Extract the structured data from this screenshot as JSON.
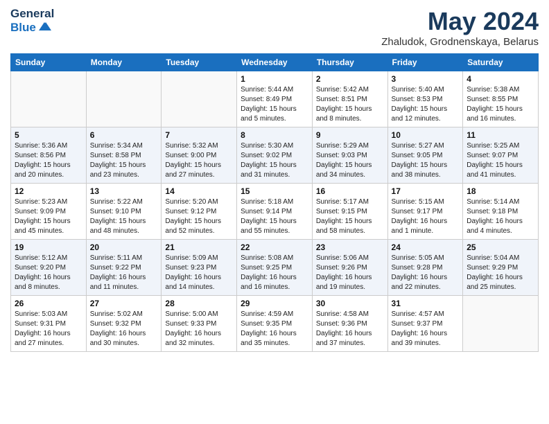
{
  "header": {
    "logo_line1": "General",
    "logo_line2": "Blue",
    "month_year": "May 2024",
    "location": "Zhaludok, Grodnenskaya, Belarus"
  },
  "days_of_week": [
    "Sunday",
    "Monday",
    "Tuesday",
    "Wednesday",
    "Thursday",
    "Friday",
    "Saturday"
  ],
  "weeks": [
    [
      {
        "day": "",
        "info": ""
      },
      {
        "day": "",
        "info": ""
      },
      {
        "day": "",
        "info": ""
      },
      {
        "day": "1",
        "info": "Sunrise: 5:44 AM\nSunset: 8:49 PM\nDaylight: 15 hours\nand 5 minutes."
      },
      {
        "day": "2",
        "info": "Sunrise: 5:42 AM\nSunset: 8:51 PM\nDaylight: 15 hours\nand 8 minutes."
      },
      {
        "day": "3",
        "info": "Sunrise: 5:40 AM\nSunset: 8:53 PM\nDaylight: 15 hours\nand 12 minutes."
      },
      {
        "day": "4",
        "info": "Sunrise: 5:38 AM\nSunset: 8:55 PM\nDaylight: 15 hours\nand 16 minutes."
      }
    ],
    [
      {
        "day": "5",
        "info": "Sunrise: 5:36 AM\nSunset: 8:56 PM\nDaylight: 15 hours\nand 20 minutes."
      },
      {
        "day": "6",
        "info": "Sunrise: 5:34 AM\nSunset: 8:58 PM\nDaylight: 15 hours\nand 23 minutes."
      },
      {
        "day": "7",
        "info": "Sunrise: 5:32 AM\nSunset: 9:00 PM\nDaylight: 15 hours\nand 27 minutes."
      },
      {
        "day": "8",
        "info": "Sunrise: 5:30 AM\nSunset: 9:02 PM\nDaylight: 15 hours\nand 31 minutes."
      },
      {
        "day": "9",
        "info": "Sunrise: 5:29 AM\nSunset: 9:03 PM\nDaylight: 15 hours\nand 34 minutes."
      },
      {
        "day": "10",
        "info": "Sunrise: 5:27 AM\nSunset: 9:05 PM\nDaylight: 15 hours\nand 38 minutes."
      },
      {
        "day": "11",
        "info": "Sunrise: 5:25 AM\nSunset: 9:07 PM\nDaylight: 15 hours\nand 41 minutes."
      }
    ],
    [
      {
        "day": "12",
        "info": "Sunrise: 5:23 AM\nSunset: 9:09 PM\nDaylight: 15 hours\nand 45 minutes."
      },
      {
        "day": "13",
        "info": "Sunrise: 5:22 AM\nSunset: 9:10 PM\nDaylight: 15 hours\nand 48 minutes."
      },
      {
        "day": "14",
        "info": "Sunrise: 5:20 AM\nSunset: 9:12 PM\nDaylight: 15 hours\nand 52 minutes."
      },
      {
        "day": "15",
        "info": "Sunrise: 5:18 AM\nSunset: 9:14 PM\nDaylight: 15 hours\nand 55 minutes."
      },
      {
        "day": "16",
        "info": "Sunrise: 5:17 AM\nSunset: 9:15 PM\nDaylight: 15 hours\nand 58 minutes."
      },
      {
        "day": "17",
        "info": "Sunrise: 5:15 AM\nSunset: 9:17 PM\nDaylight: 16 hours\nand 1 minute."
      },
      {
        "day": "18",
        "info": "Sunrise: 5:14 AM\nSunset: 9:18 PM\nDaylight: 16 hours\nand 4 minutes."
      }
    ],
    [
      {
        "day": "19",
        "info": "Sunrise: 5:12 AM\nSunset: 9:20 PM\nDaylight: 16 hours\nand 8 minutes."
      },
      {
        "day": "20",
        "info": "Sunrise: 5:11 AM\nSunset: 9:22 PM\nDaylight: 16 hours\nand 11 minutes."
      },
      {
        "day": "21",
        "info": "Sunrise: 5:09 AM\nSunset: 9:23 PM\nDaylight: 16 hours\nand 14 minutes."
      },
      {
        "day": "22",
        "info": "Sunrise: 5:08 AM\nSunset: 9:25 PM\nDaylight: 16 hours\nand 16 minutes."
      },
      {
        "day": "23",
        "info": "Sunrise: 5:06 AM\nSunset: 9:26 PM\nDaylight: 16 hours\nand 19 minutes."
      },
      {
        "day": "24",
        "info": "Sunrise: 5:05 AM\nSunset: 9:28 PM\nDaylight: 16 hours\nand 22 minutes."
      },
      {
        "day": "25",
        "info": "Sunrise: 5:04 AM\nSunset: 9:29 PM\nDaylight: 16 hours\nand 25 minutes."
      }
    ],
    [
      {
        "day": "26",
        "info": "Sunrise: 5:03 AM\nSunset: 9:31 PM\nDaylight: 16 hours\nand 27 minutes."
      },
      {
        "day": "27",
        "info": "Sunrise: 5:02 AM\nSunset: 9:32 PM\nDaylight: 16 hours\nand 30 minutes."
      },
      {
        "day": "28",
        "info": "Sunrise: 5:00 AM\nSunset: 9:33 PM\nDaylight: 16 hours\nand 32 minutes."
      },
      {
        "day": "29",
        "info": "Sunrise: 4:59 AM\nSunset: 9:35 PM\nDaylight: 16 hours\nand 35 minutes."
      },
      {
        "day": "30",
        "info": "Sunrise: 4:58 AM\nSunset: 9:36 PM\nDaylight: 16 hours\nand 37 minutes."
      },
      {
        "day": "31",
        "info": "Sunrise: 4:57 AM\nSunset: 9:37 PM\nDaylight: 16 hours\nand 39 minutes."
      },
      {
        "day": "",
        "info": ""
      }
    ]
  ]
}
